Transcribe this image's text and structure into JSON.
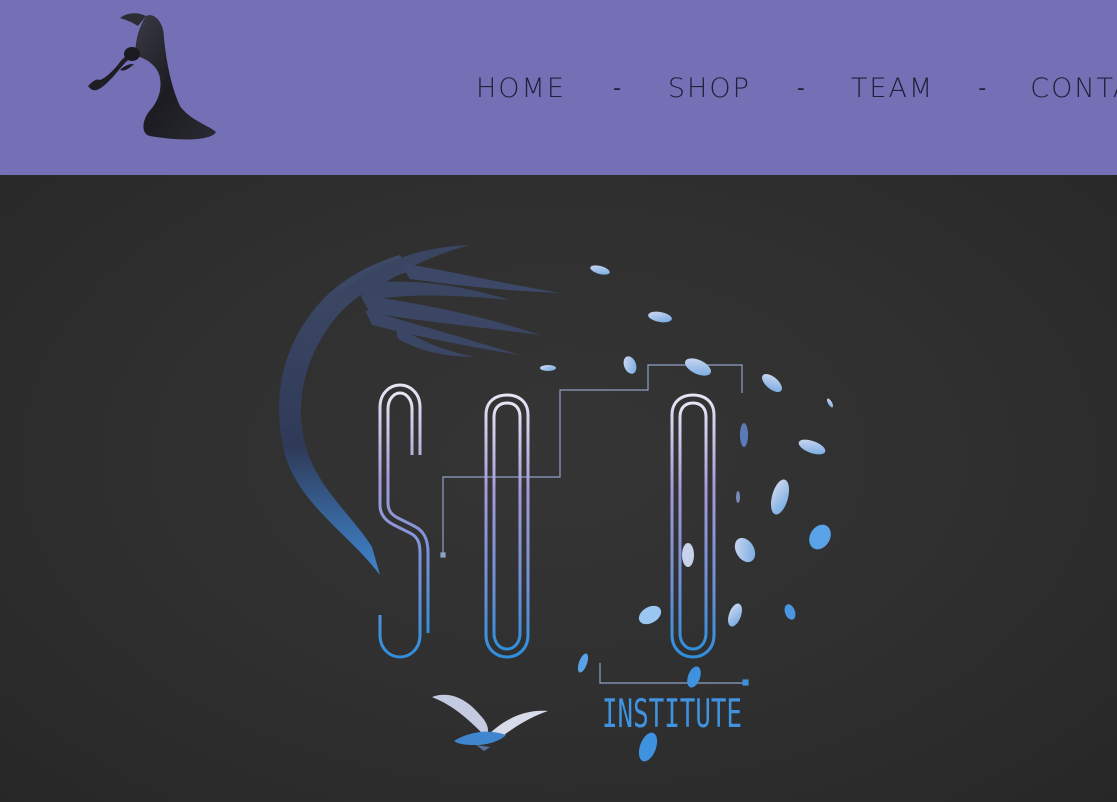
{
  "header": {
    "background_color": "#7570b5",
    "logo_icon": "abstract-figure-sculpture-logo",
    "nav": {
      "home": "HOME",
      "shop": "SHOP",
      "team": "TEAM",
      "contact": "CONTACT",
      "separator": "-"
    }
  },
  "hero": {
    "background_color": "#2e2e2e",
    "brand": {
      "title": "SŌTŌ",
      "subtitle": "INSTITUTE"
    },
    "accent_colors": {
      "gradient_top": "#b7aee6",
      "gradient_bottom": "#2e8fdc",
      "leaf_color": "#8fb7e8"
    },
    "decorative_elements": [
      "tree-branch-icon",
      "flying-bird-icon",
      "falling-leaves-icon"
    ]
  }
}
